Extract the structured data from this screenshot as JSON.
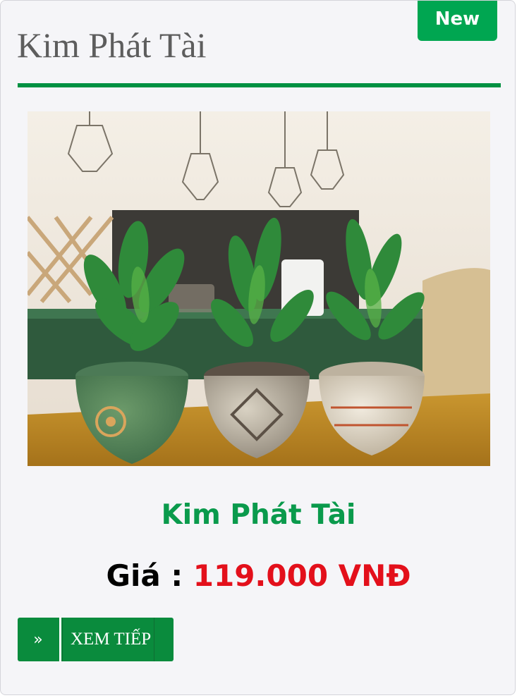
{
  "badge": {
    "label": "New"
  },
  "header": {
    "title": "Kim Phát Tài"
  },
  "product": {
    "image_alt": "Ba chậu cây Kim Phát Tài",
    "name": "Kim Phát Tài",
    "price_label": "Giá : ",
    "price_value": "119.000 VNĐ"
  },
  "actions": {
    "more_icon": "»",
    "more_label": "XEM TIẾP"
  },
  "colors": {
    "brand_green": "#00a651",
    "price_red": "#e3101b",
    "button_green": "#0a8b3d"
  }
}
